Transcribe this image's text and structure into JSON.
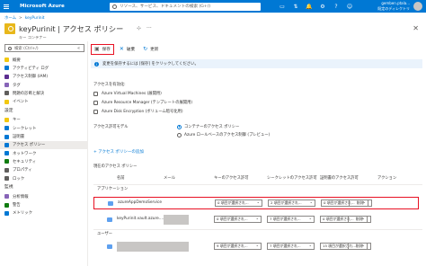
{
  "topbar": {
    "brand": "Microsoft Azure",
    "search_placeholder": "リソース、サービス、ドキュメントの検索 (G+/)",
    "account_line1": "gemben.ptala...",
    "account_line2": "既定のディレクトリ"
  },
  "breadcrumb": {
    "home": "ホーム",
    "current": "keyPurinit"
  },
  "header": {
    "title": "keyPurinit | アクセス ポリシー",
    "subtitle": "キー コンテナー"
  },
  "sidebar": {
    "search_placeholder": "検索 (Ctrl+/)",
    "items": [
      {
        "label": "概要",
        "color": "#f2c811"
      },
      {
        "label": "アクティビティ ログ",
        "color": "#0078d4"
      },
      {
        "label": "アクセス制御 (IAM)",
        "color": "#5c2d91"
      },
      {
        "label": "タグ",
        "color": "#8764b8"
      },
      {
        "label": "問題の診断と解決",
        "color": "#605e5c"
      },
      {
        "label": "イベント",
        "color": "#f2c811"
      }
    ],
    "section_settings": "設定",
    "settings_items": [
      {
        "label": "キー",
        "color": "#f2c811"
      },
      {
        "label": "シークレット",
        "color": "#0078d4"
      },
      {
        "label": "証明書",
        "color": "#0078d4"
      },
      {
        "label": "アクセス ポリシー",
        "color": "#0078d4",
        "active": true
      },
      {
        "label": "ネットワーク",
        "color": "#0078d4"
      },
      {
        "label": "セキュリティ",
        "color": "#107c10"
      },
      {
        "label": "プロパティ",
        "color": "#605e5c"
      },
      {
        "label": "ロック",
        "color": "#605e5c"
      }
    ],
    "section_monitoring": "監視",
    "monitoring_items": [
      {
        "label": "分析情報",
        "color": "#8764b8"
      },
      {
        "label": "警告",
        "color": "#107c10"
      },
      {
        "label": "メトリック",
        "color": "#0078d4"
      }
    ]
  },
  "toolbar": {
    "save": "保存",
    "discard": "破棄",
    "refresh": "更新"
  },
  "info": {
    "text": "変更を保存するには [保存] をクリックしてください。"
  },
  "access": {
    "enable_label": "アクセスを有効化:",
    "options": [
      "Azure Virtual Machines (展開用)",
      "Azure Resource Manager (テンプレートの展開用)",
      "Azure Disk Encryption (ボリューム暗号化用)"
    ],
    "permission_model_label": "アクセス許可モデル",
    "radio_vault": "コンテナーのアクセス ポリシー",
    "radio_rbac": "Azure ロールベースのアクセス制御 (プレビュー)",
    "add_policy": "+ アクセス ポリシーの追加",
    "current_policies": "現在のアクセス ポリシー"
  },
  "table": {
    "headers": [
      "名前",
      "メール",
      "キーのアクセス許可",
      "シークレットのアクセス許可",
      "証明書のアクセス許可",
      "アクション"
    ],
    "group_apps": "アプリケーション",
    "group_users": "ユーザー",
    "rows": [
      {
        "name": "azureAppDemoService",
        "perm": "0 項目が選択され...",
        "secret": "2 項目が選択され...",
        "cert": "0 項目が選択され...",
        "action": "削除"
      },
      {
        "name": "keyPurinit.vault.azure....",
        "perm": "0 項目が選択され...",
        "secret": "7 項目が選択され...",
        "cert": "0 項目が選択され...",
        "action": "削除"
      },
      {
        "name": "",
        "perm": "9 項目が選択され...",
        "secret": "7 項目が選択され...",
        "cert": "15 項目が選択され...",
        "action": "削除"
      }
    ]
  }
}
